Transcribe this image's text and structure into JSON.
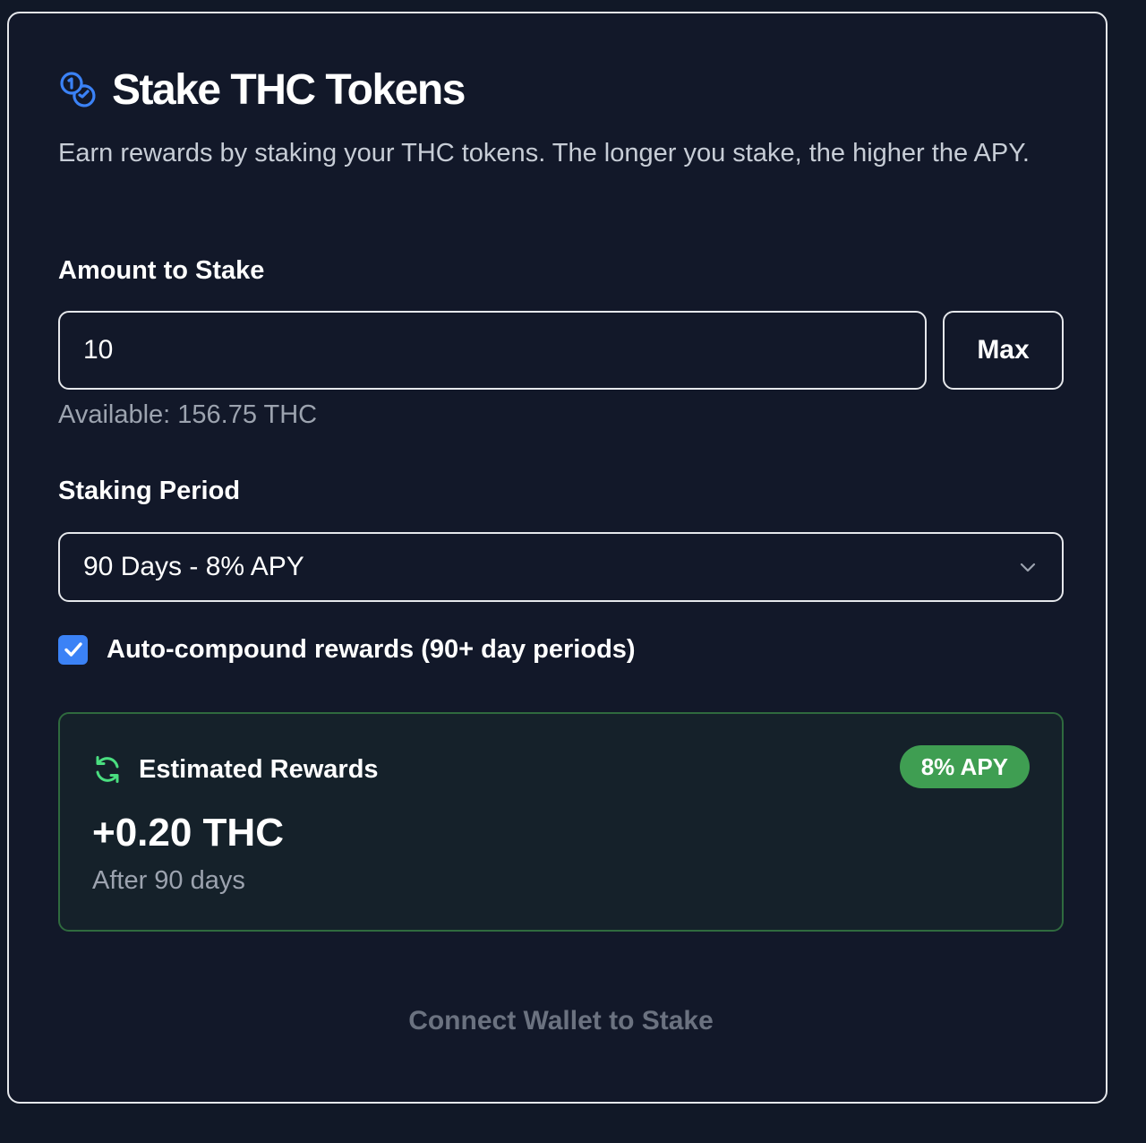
{
  "header": {
    "title": "Stake THC Tokens",
    "icon": "coins-icon",
    "subtitle": "Earn rewards by staking your THC tokens. The longer you stake, the higher the APY."
  },
  "amount": {
    "label": "Amount to Stake",
    "value": "10",
    "max_label": "Max",
    "available": "Available: 156.75 THC"
  },
  "period": {
    "label": "Staking Period",
    "selected": "90 Days - 8% APY"
  },
  "auto_compound": {
    "checked": true,
    "label": "Auto-compound rewards (90+ day periods)"
  },
  "rewards": {
    "icon": "refresh-icon",
    "title": "Estimated Rewards",
    "apy_badge": "8% APY",
    "amount": "+0.20 THC",
    "duration": "After 90 days"
  },
  "connect_button": "Connect Wallet to Stake",
  "colors": {
    "background": "#111827",
    "accent_blue": "#3b82f6",
    "accent_green": "#3f9e52",
    "muted_text": "#9ca3af"
  }
}
